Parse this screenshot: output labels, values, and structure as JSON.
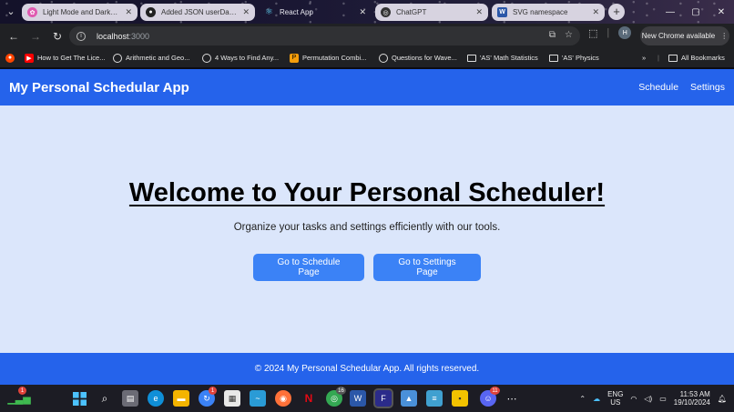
{
  "browser": {
    "tabs": [
      {
        "title": "Light Mode and Dark Mo",
        "active": false,
        "color": "#e05ab0"
      },
      {
        "title": "Added JSON userData to",
        "active": false,
        "color": "#222222"
      },
      {
        "title": "React App",
        "active": true,
        "color": "#61dafb"
      },
      {
        "title": "ChatGPT",
        "active": false,
        "color": "#333333"
      },
      {
        "title": "SVG namespace",
        "active": false,
        "color": "#2b57a8"
      }
    ],
    "address": {
      "host": "localhost",
      "port": ":3000"
    },
    "chrome_available": "New Chrome available",
    "avatar_initial": "H",
    "bookmarks": [
      {
        "label": "How to Get The Lice...",
        "icon": "youtube-icon"
      },
      {
        "label": "Arithmetic and Geo...",
        "icon": "globe-icon"
      },
      {
        "label": "4 Ways to Find Any...",
        "icon": "globe-icon"
      },
      {
        "label": "Permutation Combi...",
        "icon": "site-icon"
      },
      {
        "label": "Questions for Wave...",
        "icon": "globe-icon"
      },
      {
        "label": "'AS' Math Statistics",
        "icon": "folder-icon"
      },
      {
        "label": "'AS' Physics",
        "icon": "folder-icon"
      }
    ],
    "all_bookmarks": "All Bookmarks"
  },
  "app": {
    "title": "My Personal Schedular App",
    "nav": {
      "schedule": "Schedule",
      "settings": "Settings"
    },
    "hero": {
      "title": "Welcome to Your Personal Scheduler!",
      "subtitle": "Organize your tasks and settings efficiently with our tools."
    },
    "buttons": {
      "schedule": "Go to Schedule Page",
      "settings": "Go to Settings Page"
    },
    "footer": "© 2024 My Personal Schedular App. All rights reserved.",
    "colors": {
      "primary": "#2563eb",
      "button": "#3b82f6",
      "background": "#dbe6fb"
    }
  },
  "taskbar": {
    "lang_top": "ENG",
    "lang_bottom": "US",
    "time": "11:53 AM",
    "date": "19/10/2024",
    "badges": {
      "stocks": "1",
      "updates": "1",
      "chrome": "16",
      "discord": "11"
    }
  }
}
